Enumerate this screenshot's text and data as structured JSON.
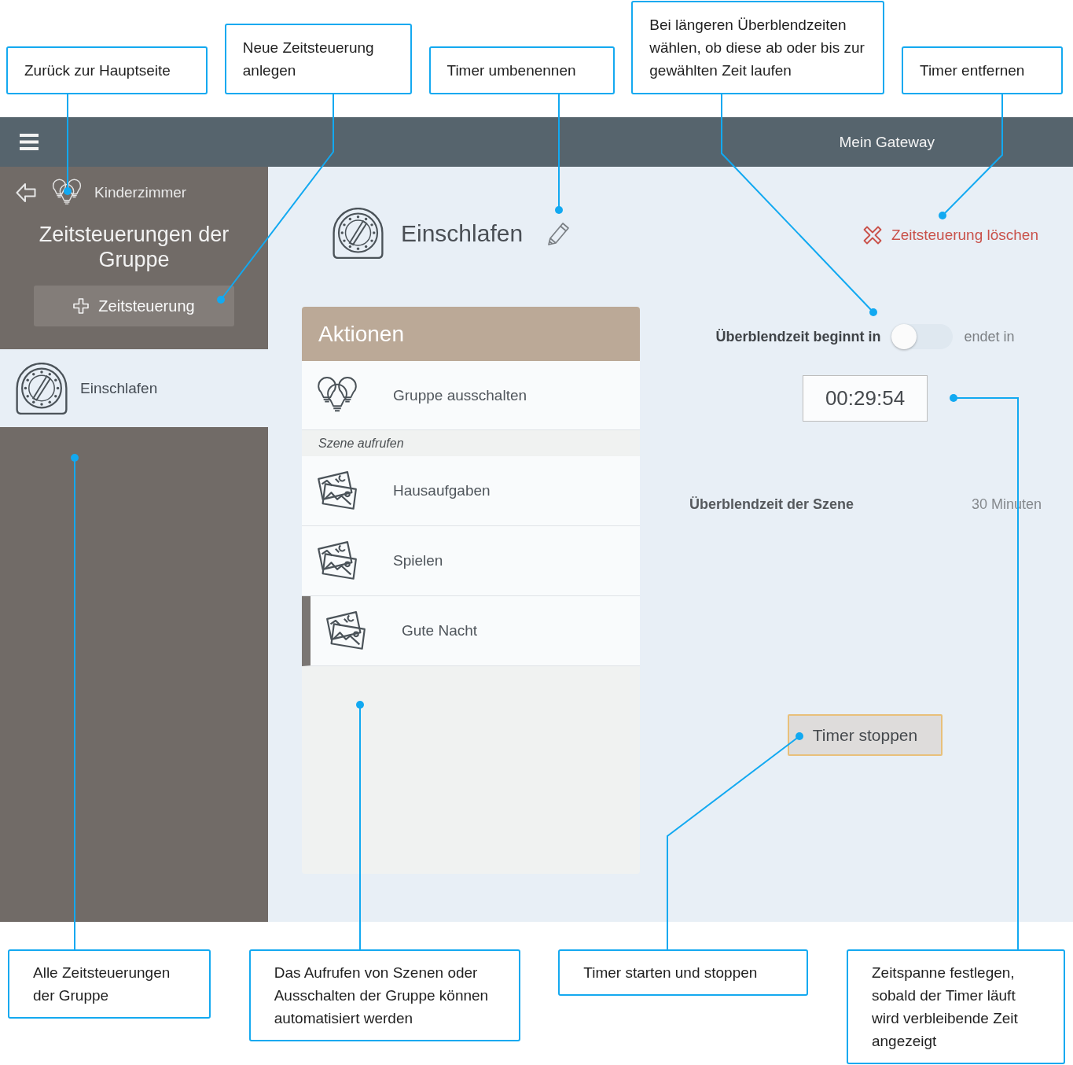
{
  "callouts_top": [
    "Zurück zur Hauptseite",
    "Neue Zeitsteuerung anlegen",
    "Timer umbenennen",
    "Bei längeren Überblendzeiten wählen, ob diese ab oder bis zur gewählten Zeit laufen",
    "Timer entfernen"
  ],
  "top_bar": {
    "title": "Mein Gateway"
  },
  "sidebar": {
    "group_name": "Kinderzimmer",
    "heading": "Zeitsteuerungen der Gruppe",
    "add_button": "Zeitsteuerung",
    "items": [
      {
        "label": "Einschlafen",
        "selected": true
      }
    ]
  },
  "schedule": {
    "title": "Einschlafen",
    "delete_link": "Zeitsteuerung löschen"
  },
  "actions": {
    "title": "Aktionen",
    "group_action": {
      "label": "Gruppe ausschalten",
      "selected": false
    },
    "scene_heading": "Szene aufrufen",
    "scenes": [
      {
        "label": "Hausaufgaben",
        "selected": false
      },
      {
        "label": "Spielen",
        "selected": false
      },
      {
        "label": "Gute Nacht",
        "selected": true
      }
    ]
  },
  "settings": {
    "toggle_label_start": "Überblendzeit beginnt in",
    "toggle_on": false,
    "toggle_label_end": "endet in",
    "remaining_time": "00:29:54",
    "scene_fade_label": "Überblendzeit der Szene",
    "scene_fade_value": "30 Minuten",
    "timer_button": "Timer stoppen"
  },
  "callouts_bottom": [
    "Alle Zeitsteuerungen der Gruppe",
    "Das Aufrufen von Szenen oder Ausschalten der Gruppe können automatisiert werden",
    "Timer starten und stoppen",
    "Zeitspanne festlegen, sobald der Timer läuft wird verbleibende Zeit angezeigt"
  ]
}
